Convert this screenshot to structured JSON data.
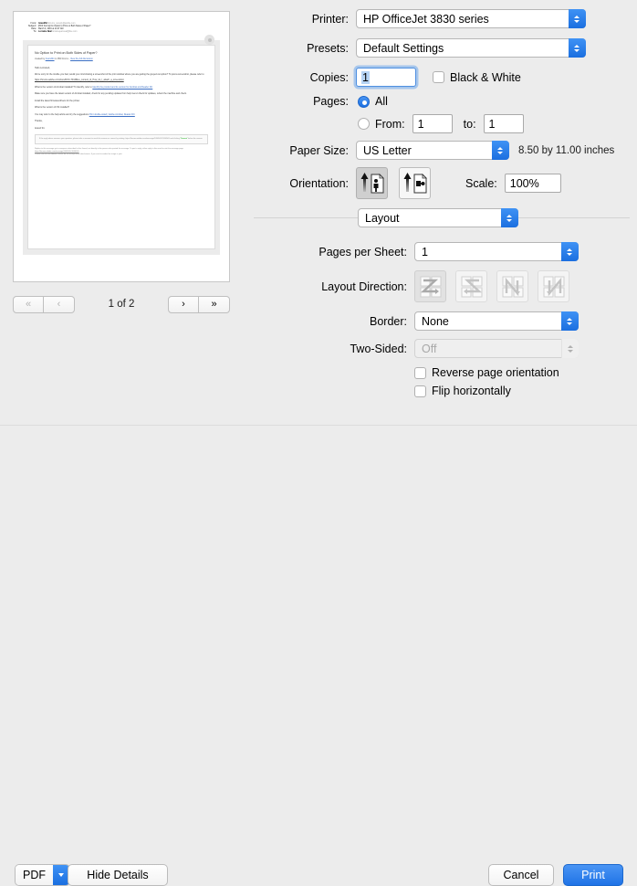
{
  "preview": {
    "email_header": [
      {
        "label": "From:",
        "value": "AnandSri",
        "rest": "forums_noreply@adobe.com"
      },
      {
        "label": "Subject:",
        "value": "",
        "rest": "[PDF Forms] No Option to Print on Both Sides of Paper?"
      },
      {
        "label": "Date:",
        "value": "",
        "rest": "March 4, 2016 at 11:07 AM"
      },
      {
        "label": "To:",
        "value": "Lorraine Neal",
        "rest": "lorrainejeanneal@live.com"
      }
    ],
    "message": {
      "title": "No Option to Print on Both Sides of Paper?",
      "created_by_prefix": "created by ",
      "author": "AnandSri",
      "in_text": " in ",
      "forum": "PDF Forms",
      "dash": " - ",
      "discussion_link": "View the full discussion",
      "greeting": "Hello Lorraineb,",
      "paragraph_1": "We're sorry for the trouble you had, would you mind sharing a screenshot of the print window where you are getting the greyed out option? To post a screenshot, please refer to",
      "link_1": "https://forums.adobe.com/docs/DOC-7043#live_content_id_How_do_I_attach_a_screenshot",
      "paragraph_2": "What is the version of Acrobat installed? To identify, refer to",
      "link_2": "Identify the product and its version for Acrobat and Reader DC",
      "paragraph_3": "Make sure you have the latest version of Acrobat installed, check for any pending updates from help menu>check for updates, reboot the machine and check.",
      "paragraph_4": "Install the latest firmware/drivers for the printer.",
      "paragraph_5": "What is the version of OS installed?",
      "paragraph_6": "You may refer to the help article and try the suggestions",
      "link_3": "Print double-sided | Adobe Acrobat, Reader DC",
      "signoff": "Thanks,",
      "signature": "Anand Sri.",
      "notice": "If the reply above answers your question, please take a moment to mark this answer as correct by visiting: https://forums.adobe.com/message/1096505#1096505 and clicking",
      "notice_highlight": "'Correct'",
      "notice_tail": " below the answer",
      "footer_1": "Replies to this message go to everyone subscribed to this thread, not directly to the person who posted the message. To post a reply, either reply to this email or visit the message page.",
      "footer_link": "https://forums.adobe.com/message/1096505#1096505",
      "footer_2": "Please note that the Adobe Forums do not accept email attachments. If you want to embed an image in your"
    },
    "navigation": {
      "first_label": "«",
      "prev_label": "‹",
      "next_label": "›",
      "last_label": "»",
      "counter": "1 of 2"
    }
  },
  "settings": {
    "printer": {
      "label": "Printer:",
      "value": "HP OfficeJet 3830 series"
    },
    "presets": {
      "label": "Presets:",
      "value": "Default Settings"
    },
    "copies": {
      "label": "Copies:",
      "value": "1"
    },
    "black_white": {
      "label": "Black & White",
      "checked": false
    },
    "pages": {
      "label": "Pages:",
      "all_label": "All",
      "all_selected": true,
      "from_label": "From:",
      "from_value": "1",
      "to_label": "to:",
      "to_value": "1"
    },
    "paper_size": {
      "label": "Paper Size:",
      "value": "US Letter",
      "dimensions": "8.50 by 11.00 inches"
    },
    "orientation": {
      "label": "Orientation:",
      "portrait_icon": "portrait-orientation-icon",
      "landscape_icon": "landscape-orientation-icon",
      "selected": "portrait"
    },
    "scale": {
      "label": "Scale:",
      "value": "100%"
    },
    "pane": {
      "value": "Layout"
    },
    "pages_per_sheet": {
      "label": "Pages per Sheet:",
      "value": "1"
    },
    "layout_direction": {
      "label": "Layout Direction:",
      "options": [
        "z-right-down-icon",
        "z-left-down-icon",
        "n-down-right-icon",
        "n-down-left-icon"
      ],
      "selected_index": 0,
      "disabled": true
    },
    "border": {
      "label": "Border:",
      "value": "None"
    },
    "two_sided": {
      "label": "Two-Sided:",
      "value": "Off",
      "disabled": true
    },
    "reverse_page_orientation": {
      "label": "Reverse page orientation",
      "checked": false
    },
    "flip_horizontally": {
      "label": "Flip horizontally",
      "checked": false
    }
  },
  "footer": {
    "pdf_label": "PDF",
    "hide_details_label": "Hide Details",
    "cancel_label": "Cancel",
    "print_label": "Print"
  },
  "colors": {
    "accent_blue": "#1f73e6",
    "window_bg": "#ececec",
    "selection_blue": "#b6d4f5"
  }
}
